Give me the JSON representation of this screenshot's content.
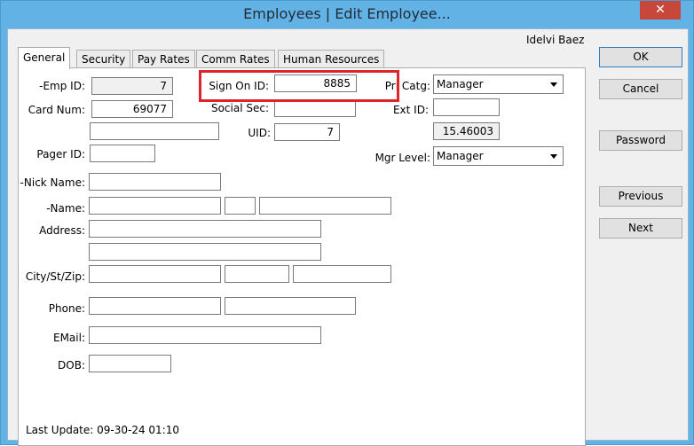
{
  "window": {
    "title": "Employees | Edit Employee...",
    "close_glyph": "✕"
  },
  "user_name": "Idelvi Baez",
  "tabs": [
    {
      "label": "General",
      "active": true
    },
    {
      "label": "Security",
      "active": false
    },
    {
      "label": "Pay Rates",
      "active": false
    },
    {
      "label": "Comm Rates",
      "active": false
    },
    {
      "label": "Human Resources",
      "active": false
    }
  ],
  "form": {
    "emp_id": {
      "label": "-Emp ID:",
      "value": "7"
    },
    "sign_on_id": {
      "label": "Sign On ID:",
      "value": "8885"
    },
    "pri_catg": {
      "label": "Pri Catg:",
      "value": "Manager"
    },
    "card_num": {
      "label": "Card Num:",
      "value": "69077"
    },
    "social_sec": {
      "label": "Social Sec:",
      "value": ""
    },
    "ext_id": {
      "label": "Ext ID:",
      "value": ""
    },
    "uid": {
      "label": "UID:",
      "value": "7"
    },
    "unlabeled_value": "15.46003",
    "pager_id": {
      "label": "Pager ID:",
      "value": ""
    },
    "mgr_level": {
      "label": "Mgr Level:",
      "value": "Manager"
    },
    "nick_name": {
      "label": "-Nick Name:",
      "value": ""
    },
    "name": {
      "label": "-Name:"
    },
    "address": {
      "label": "Address:"
    },
    "city_st_zip": {
      "label": "City/St/Zip:"
    },
    "phone": {
      "label": "Phone:"
    },
    "email": {
      "label": "EMail:"
    },
    "dob": {
      "label": "DOB:"
    }
  },
  "buttons": {
    "ok": "OK",
    "cancel": "Cancel",
    "password": "Password",
    "previous": "Previous",
    "next": "Next"
  },
  "last_update": "Last Update: 09-30-24 01:10",
  "colors": {
    "title_bar": "#63b2e6",
    "close_button": "#c7473b",
    "highlight": "#e0232a"
  }
}
